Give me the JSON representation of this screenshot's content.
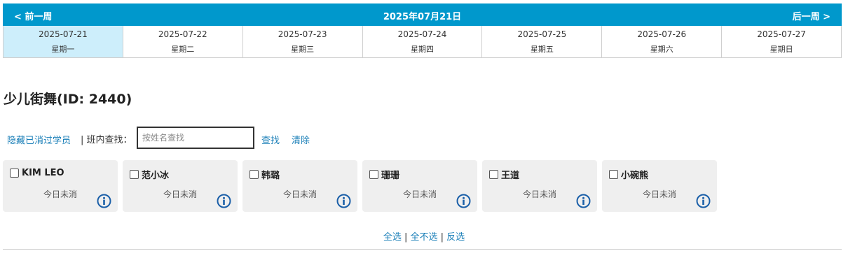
{
  "week_nav": {
    "prev_label": "< 前一周",
    "title": "2025年07月21日",
    "next_label": "后一周 >"
  },
  "days": [
    {
      "date": "2025-07-21",
      "weekday": "星期一",
      "active": true
    },
    {
      "date": "2025-07-22",
      "weekday": "星期二",
      "active": false
    },
    {
      "date": "2025-07-23",
      "weekday": "星期三",
      "active": false
    },
    {
      "date": "2025-07-24",
      "weekday": "星期四",
      "active": false
    },
    {
      "date": "2025-07-25",
      "weekday": "星期五",
      "active": false
    },
    {
      "date": "2025-07-26",
      "weekday": "星期六",
      "active": false
    },
    {
      "date": "2025-07-27",
      "weekday": "星期日",
      "active": false
    }
  ],
  "class_title": "少儿街舞(ID: 2440)",
  "toolbar": {
    "hide_label": "隐藏已消过学员",
    "search_label": "| 班内查找：",
    "search_placeholder": "按姓名查找",
    "search_value": "",
    "find_label": "查找",
    "clear_label": "清除"
  },
  "students": [
    {
      "name": "KIM LEO",
      "status": "今日未消",
      "checked": false
    },
    {
      "name": "范小冰",
      "status": "今日未消",
      "checked": false
    },
    {
      "name": "韩璐",
      "status": "今日未消",
      "checked": false
    },
    {
      "name": "珊珊",
      "status": "今日未消",
      "checked": false
    },
    {
      "name": "王道",
      "status": "今日未消",
      "checked": false
    },
    {
      "name": "小碗熊",
      "status": "今日未消",
      "checked": false
    }
  ],
  "selection": {
    "select_all": "全选",
    "select_none": "全不选",
    "invert": "反选",
    "separator": " | "
  },
  "colors": {
    "header_bg": "#0098cc",
    "active_day_bg": "#cdeefb",
    "link": "#1a7fb8",
    "card_bg": "#efefef"
  }
}
